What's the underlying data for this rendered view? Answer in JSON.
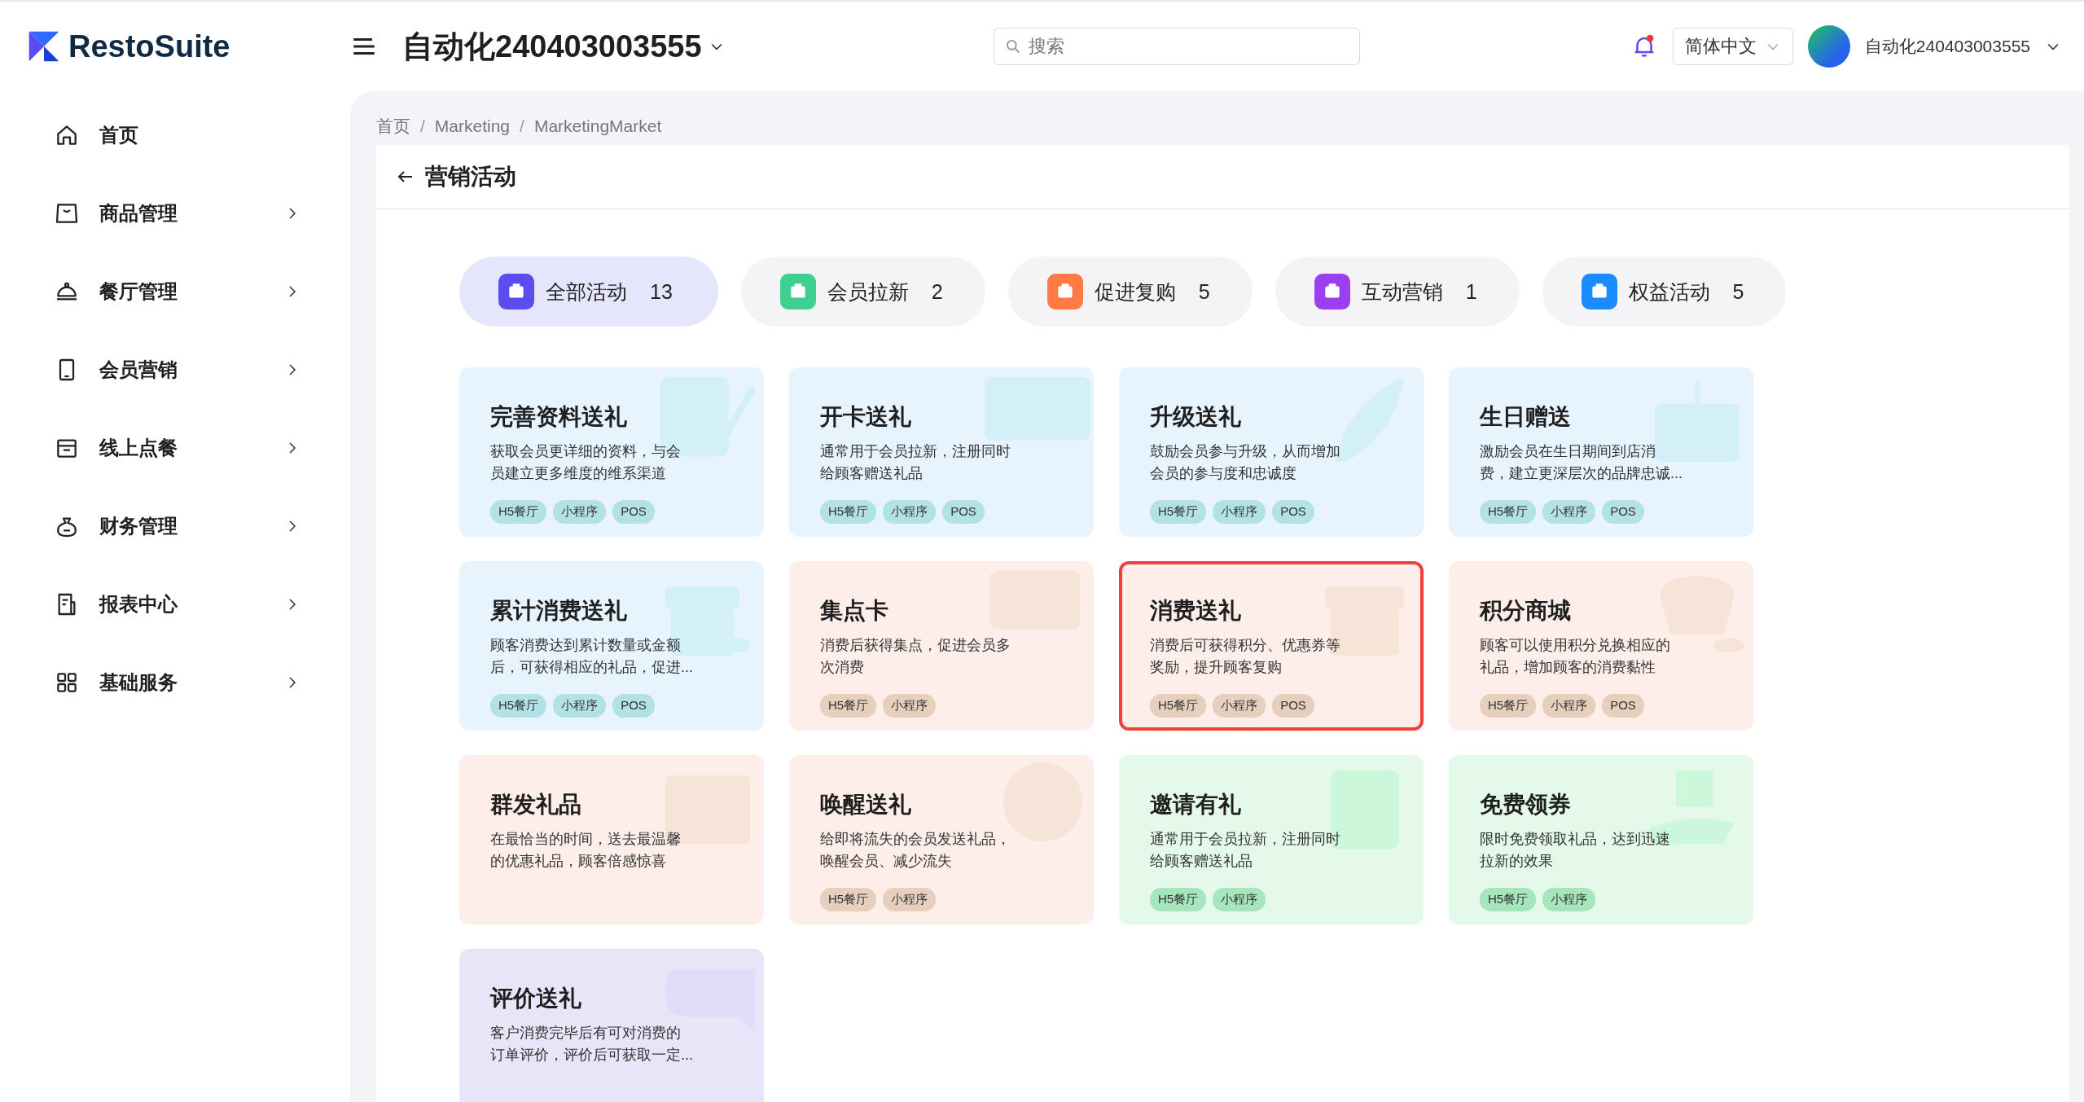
{
  "brand": {
    "name": "RestoSuite"
  },
  "header": {
    "store": "自动化240403003555",
    "search": {
      "placeholder": "搜索"
    },
    "notifications": {
      "unread": true
    },
    "language": "简体中文",
    "user": "自动化240403003555"
  },
  "sidebar": {
    "items": [
      {
        "label": "首页",
        "expandable": false
      },
      {
        "label": "商品管理",
        "expandable": true
      },
      {
        "label": "餐厅管理",
        "expandable": true
      },
      {
        "label": "会员营销",
        "expandable": true
      },
      {
        "label": "线上点餐",
        "expandable": true
      },
      {
        "label": "财务管理",
        "expandable": true
      },
      {
        "label": "报表中心",
        "expandable": true
      },
      {
        "label": "基础服务",
        "expandable": true
      }
    ]
  },
  "breadcrumb": [
    {
      "kind": "link",
      "text": "首页"
    },
    {
      "kind": "separator",
      "text": "/"
    },
    {
      "kind": "link",
      "text": "Marketing"
    },
    {
      "kind": "separator",
      "text": "/"
    },
    {
      "kind": "link",
      "text": "MarketingMarket"
    }
  ],
  "page_title": "营销活动",
  "tabs": [
    {
      "label": "全部活动",
      "count": "13",
      "color": "#5b4cf0",
      "selected": true
    },
    {
      "label": "会员拉新",
      "count": "2",
      "color": "#3fcf8e",
      "selected": false
    },
    {
      "label": "促进复购",
      "count": "5",
      "color": "#ff7a45",
      "selected": false
    },
    {
      "label": "互动营销",
      "count": "1",
      "color": "#9b3ff0",
      "selected": false
    },
    {
      "label": "权益活动",
      "count": "5",
      "color": "#1a8cff",
      "selected": false
    }
  ],
  "cards": [
    {
      "title": "完善资料送礼",
      "description": "获取会员更详细的资料，与会员建立更多维度的维系渠道",
      "tags": [
        "H5餐厅",
        "小程序",
        "POS"
      ],
      "color": "#e7f4fe",
      "selected": false
    },
    {
      "title": "开卡送礼",
      "description": "通常用于会员拉新，注册同时给顾客赠送礼品",
      "tags": [
        "H5餐厅",
        "小程序",
        "POS"
      ],
      "color": "#e7f4fe",
      "selected": false
    },
    {
      "title": "升级送礼",
      "description": "鼓励会员参与升级，从而增加会员的参与度和忠诚度",
      "tags": [
        "H5餐厅",
        "小程序",
        "POS"
      ],
      "color": "#e7f4fe",
      "selected": false
    },
    {
      "title": "生日赠送",
      "description": "激励会员在生日期间到店消费，建立更深层次的品牌忠诚...",
      "tags": [
        "H5餐厅",
        "小程序",
        "POS"
      ],
      "color": "#e7f4fe",
      "selected": false
    },
    {
      "title": "累计消费送礼",
      "description": "顾客消费达到累计数量或金额后，可获得相应的礼品，促进...",
      "tags": [
        "H5餐厅",
        "小程序",
        "POS"
      ],
      "color": "#e7f4fe",
      "selected": false
    },
    {
      "title": "集点卡",
      "description": "消费后获得集点，促进会员多次消费",
      "tags": [
        "H5餐厅",
        "小程序"
      ],
      "color": "#fdeee9",
      "selected": false
    },
    {
      "title": "消费送礼",
      "description": "消费后可获得积分、优惠券等奖励，提升顾客复购",
      "tags": [
        "H5餐厅",
        "小程序",
        "POS"
      ],
      "color": "#fdeee9",
      "selected": true
    },
    {
      "title": "积分商城",
      "description": "顾客可以使用积分兑换相应的礼品，增加顾客的消费黏性",
      "tags": [
        "H5餐厅",
        "小程序",
        "POS"
      ],
      "color": "#fdeee9",
      "selected": false
    },
    {
      "title": "群发礼品",
      "description": "在最恰当的时间，送去最温馨的优惠礼品，顾客倍感惊喜",
      "color": "#fdeee9",
      "selected": false
    },
    {
      "title": "唤醒送礼",
      "description": "给即将流失的会员发送礼品，唤醒会员、减少流失",
      "tags": [
        "H5餐厅",
        "小程序"
      ],
      "color": "#fdeee9",
      "selected": false
    },
    {
      "title": "邀请有礼",
      "description": "通常用于会员拉新，注册同时给顾客赠送礼品",
      "tags": [
        "H5餐厅",
        "小程序"
      ],
      "color": "#e5f9eb",
      "selected": false
    },
    {
      "title": "免费领券",
      "description": "限时免费领取礼品，达到迅速拉新的效果",
      "tags": [
        "H5餐厅",
        "小程序"
      ],
      "color": "#e5f9eb",
      "selected": false
    },
    {
      "title": "评价送礼",
      "description": "客户消费完毕后有可对消费的订单评价，评价后可获取一定...",
      "color": "#e7e6f9",
      "selected": false
    }
  ]
}
